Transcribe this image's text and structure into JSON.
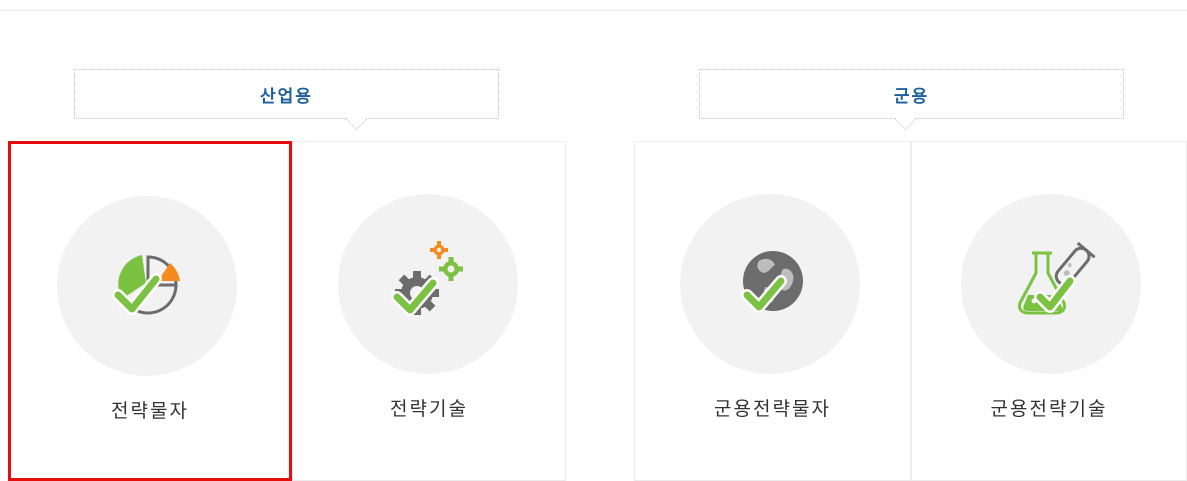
{
  "colors": {
    "accent_blue": "#1d5f9c",
    "selected_border": "#e40e0e",
    "check_green": "#7cc242",
    "icon_orange": "#f58a1f",
    "icon_gray": "#6c6c6c"
  },
  "groups": {
    "industrial": {
      "label": "산업용"
    },
    "military": {
      "label": "군용"
    }
  },
  "cards": [
    {
      "label": "전략물자",
      "icon": "pie-chart-check-icon",
      "selected": true
    },
    {
      "label": "전략기술",
      "icon": "gears-check-icon",
      "selected": false
    },
    {
      "label": "군용전략물자",
      "icon": "globe-check-icon",
      "selected": false
    },
    {
      "label": "군용전략기술",
      "icon": "flask-check-icon",
      "selected": false
    }
  ]
}
